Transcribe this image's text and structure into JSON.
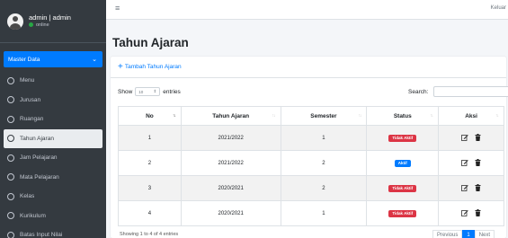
{
  "user": {
    "name": "admin | admin",
    "status": "online"
  },
  "sidebar": {
    "section": "Master Data",
    "items": [
      {
        "label": "Menu"
      },
      {
        "label": "Jurusan"
      },
      {
        "label": "Ruangan"
      },
      {
        "label": "Tahun Ajaran"
      },
      {
        "label": "Jam Pelajaran"
      },
      {
        "label": "Mata Pelajaran"
      },
      {
        "label": "Kelas"
      },
      {
        "label": "Kurikulum"
      },
      {
        "label": "Batas Input Nilai"
      }
    ],
    "active_index": 3
  },
  "navbar": {
    "logout": "Keluar"
  },
  "page": {
    "title": "Tahun Ajaran",
    "add_label": "Tambah Tahun Ajaran"
  },
  "table_controls": {
    "show": "Show",
    "entries_value": "10",
    "entries": "entries",
    "search": "Search:"
  },
  "table": {
    "columns": [
      "No",
      "Tahun Ajaran",
      "Semester",
      "Status",
      "Aksi"
    ],
    "rows": [
      {
        "no": "1",
        "tahun": "2021/2022",
        "semester": "1",
        "status": "Tidak Aktif"
      },
      {
        "no": "2",
        "tahun": "2021/2022",
        "semester": "2",
        "status": "Aktif"
      },
      {
        "no": "3",
        "tahun": "2020/2021",
        "semester": "2",
        "status": "Tidak Aktif"
      },
      {
        "no": "4",
        "tahun": "2020/2021",
        "semester": "1",
        "status": "Tidak Aktif"
      }
    ]
  },
  "footer": {
    "info": "Showing 1 to 4 of 4 entries"
  },
  "pagination": {
    "previous": "Previous",
    "current": "1",
    "next": "Next"
  },
  "colors": {
    "primary": "#007bff",
    "sidebar": "#343a40",
    "danger": "#dc3545"
  }
}
